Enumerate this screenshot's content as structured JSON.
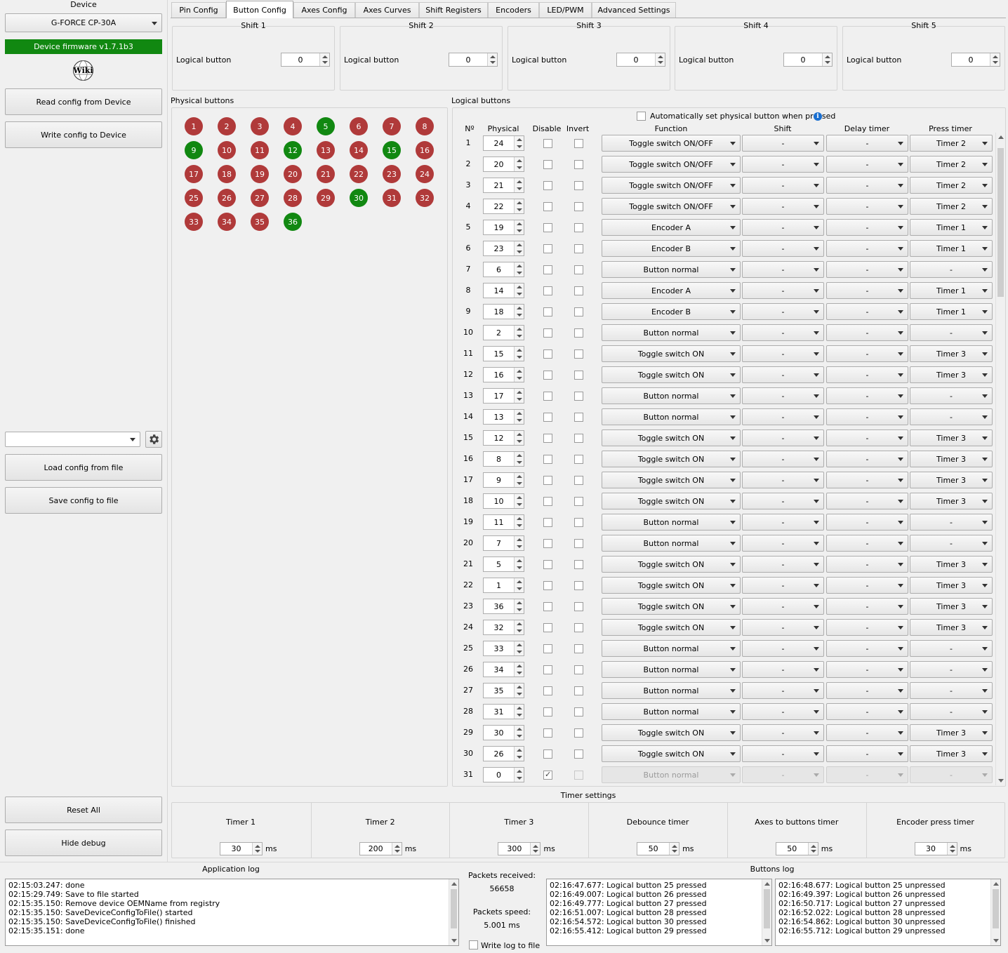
{
  "device": {
    "label": "Device",
    "selected": "G-FORCE CP-30A",
    "firmware": "Device firmware v1.7.1b3",
    "wiki": "Wiki",
    "read": "Read config from Device",
    "write": "Write config to Device",
    "load": "Load config from file",
    "save": "Save config to file",
    "reset": "Reset All",
    "hide_debug": "Hide debug",
    "config_select": ""
  },
  "tabs": [
    "Pin Config",
    "Button Config",
    "Axes Config",
    "Axes Curves",
    "Shift Registers",
    "Encoders",
    "LED/PWM",
    "Advanced Settings"
  ],
  "active_tab": 1,
  "shifts": [
    {
      "title": "Shift 1",
      "label": "Logical button",
      "value": "0"
    },
    {
      "title": "Shift 2",
      "label": "Logical button",
      "value": "0"
    },
    {
      "title": "Shift 3",
      "label": "Logical button",
      "value": "0"
    },
    {
      "title": "Shift 4",
      "label": "Logical button",
      "value": "0"
    },
    {
      "title": "Shift 5",
      "label": "Logical button",
      "value": "0"
    }
  ],
  "physical": {
    "title": "Physical buttons",
    "green": [
      5,
      9,
      12,
      15,
      30,
      36
    ],
    "buttons": [
      "1",
      "2",
      "3",
      "4",
      "5",
      "6",
      "7",
      "8",
      "9",
      "10",
      "11",
      "12",
      "13",
      "14",
      "15",
      "16",
      "17",
      "18",
      "19",
      "20",
      "21",
      "22",
      "23",
      "24",
      "25",
      "26",
      "27",
      "28",
      "29",
      "30",
      "31",
      "32",
      "33",
      "34",
      "35",
      "36"
    ]
  },
  "logical": {
    "title": "Logical buttons",
    "auto_set": "Automatically set physical button when pressed",
    "headers": {
      "num": "Nº",
      "physical": "Physical",
      "disable": "Disable",
      "invert": "Invert",
      "function": "Function",
      "shift": "Shift",
      "delay": "Delay timer",
      "press": "Press timer"
    },
    "rows": [
      {
        "n": "1",
        "p": "24",
        "f": "Toggle switch ON/OFF",
        "s": "-",
        "d": "-",
        "t": "Timer 2"
      },
      {
        "n": "2",
        "p": "20",
        "f": "Toggle switch ON/OFF",
        "s": "-",
        "d": "-",
        "t": "Timer 2"
      },
      {
        "n": "3",
        "p": "21",
        "f": "Toggle switch ON/OFF",
        "s": "-",
        "d": "-",
        "t": "Timer 2"
      },
      {
        "n": "4",
        "p": "22",
        "f": "Toggle switch ON/OFF",
        "s": "-",
        "d": "-",
        "t": "Timer 2"
      },
      {
        "n": "5",
        "p": "19",
        "f": "Encoder A",
        "s": "-",
        "d": "-",
        "t": "Timer 1"
      },
      {
        "n": "6",
        "p": "23",
        "f": "Encoder B",
        "s": "-",
        "d": "-",
        "t": "Timer 1"
      },
      {
        "n": "7",
        "p": "6",
        "f": "Button normal",
        "s": "-",
        "d": "-",
        "t": "-"
      },
      {
        "n": "8",
        "p": "14",
        "f": "Encoder A",
        "s": "-",
        "d": "-",
        "t": "Timer 1"
      },
      {
        "n": "9",
        "p": "18",
        "f": "Encoder B",
        "s": "-",
        "d": "-",
        "t": "Timer 1"
      },
      {
        "n": "10",
        "p": "2",
        "f": "Button normal",
        "s": "-",
        "d": "-",
        "t": "-"
      },
      {
        "n": "11",
        "p": "15",
        "f": "Toggle switch ON",
        "s": "-",
        "d": "-",
        "t": "Timer 3"
      },
      {
        "n": "12",
        "p": "16",
        "f": "Toggle switch ON",
        "s": "-",
        "d": "-",
        "t": "Timer 3"
      },
      {
        "n": "13",
        "p": "17",
        "f": "Button normal",
        "s": "-",
        "d": "-",
        "t": "-"
      },
      {
        "n": "14",
        "p": "13",
        "f": "Button normal",
        "s": "-",
        "d": "-",
        "t": "-"
      },
      {
        "n": "15",
        "p": "12",
        "f": "Toggle switch ON",
        "s": "-",
        "d": "-",
        "t": "Timer 3"
      },
      {
        "n": "16",
        "p": "8",
        "f": "Toggle switch ON",
        "s": "-",
        "d": "-",
        "t": "Timer 3"
      },
      {
        "n": "17",
        "p": "9",
        "f": "Toggle switch ON",
        "s": "-",
        "d": "-",
        "t": "Timer 3"
      },
      {
        "n": "18",
        "p": "10",
        "f": "Toggle switch ON",
        "s": "-",
        "d": "-",
        "t": "Timer 3"
      },
      {
        "n": "19",
        "p": "11",
        "f": "Button normal",
        "s": "-",
        "d": "-",
        "t": "-"
      },
      {
        "n": "20",
        "p": "7",
        "f": "Button normal",
        "s": "-",
        "d": "-",
        "t": "-"
      },
      {
        "n": "21",
        "p": "5",
        "f": "Toggle switch ON",
        "s": "-",
        "d": "-",
        "t": "Timer 3"
      },
      {
        "n": "22",
        "p": "1",
        "f": "Toggle switch ON",
        "s": "-",
        "d": "-",
        "t": "Timer 3"
      },
      {
        "n": "23",
        "p": "36",
        "f": "Toggle switch ON",
        "s": "-",
        "d": "-",
        "t": "Timer 3"
      },
      {
        "n": "24",
        "p": "32",
        "f": "Toggle switch ON",
        "s": "-",
        "d": "-",
        "t": "Timer 3"
      },
      {
        "n": "25",
        "p": "33",
        "f": "Button normal",
        "s": "-",
        "d": "-",
        "t": "-"
      },
      {
        "n": "26",
        "p": "34",
        "f": "Button normal",
        "s": "-",
        "d": "-",
        "t": "-"
      },
      {
        "n": "27",
        "p": "35",
        "f": "Button normal",
        "s": "-",
        "d": "-",
        "t": "-"
      },
      {
        "n": "28",
        "p": "31",
        "f": "Button normal",
        "s": "-",
        "d": "-",
        "t": "-"
      },
      {
        "n": "29",
        "p": "30",
        "f": "Toggle switch ON",
        "s": "-",
        "d": "-",
        "t": "Timer 3"
      },
      {
        "n": "30",
        "p": "26",
        "f": "Toggle switch ON",
        "s": "-",
        "d": "-",
        "t": "Timer 3"
      },
      {
        "n": "31",
        "p": "0",
        "f": "Button normal",
        "s": "-",
        "d": "-",
        "t": "-",
        "disabled": true
      }
    ]
  },
  "timers": {
    "title": "Timer settings",
    "items": [
      {
        "label": "Timer 1",
        "value": "30",
        "unit": "ms"
      },
      {
        "label": "Timer 2",
        "value": "200",
        "unit": "ms"
      },
      {
        "label": "Timer 3",
        "value": "300",
        "unit": "ms"
      },
      {
        "label": "Debounce timer",
        "value": "50",
        "unit": "ms"
      },
      {
        "label": "Axes to buttons timer",
        "value": "50",
        "unit": "ms"
      },
      {
        "label": "Encoder press timer",
        "value": "30",
        "unit": "ms"
      }
    ]
  },
  "app_log": {
    "title": "Application log",
    "lines": [
      "02:15:03.247: done",
      "02:15:29.749: Save to file started",
      "02:15:35.150: Remove device OEMName from registry",
      "02:15:35.150: SaveDeviceConfigToFile() started",
      "02:15:35.150: SaveDeviceConfigToFile() finished",
      "02:15:35.151: done"
    ]
  },
  "packets": {
    "received_label": "Packets received:",
    "received": "56658",
    "speed_label": "Packets speed:",
    "speed": "5.001 ms",
    "write_log": "Write log to file"
  },
  "buttons_log": {
    "title": "Buttons log",
    "pressed": [
      "02:16:47.677: Logical button 25 pressed",
      "02:16:49.007: Logical button 26 pressed",
      "02:16:49.777: Logical button 27 pressed",
      "02:16:51.007: Logical button 28 pressed",
      "02:16:54.572: Logical button 30 pressed",
      "02:16:55.412: Logical button 29 pressed"
    ],
    "unpressed": [
      "02:16:48.677: Logical button 25 unpressed",
      "02:16:49.397: Logical button 26 unpressed",
      "02:16:50.717: Logical button 27 unpressed",
      "02:16:52.022: Logical button 28 unpressed",
      "02:16:54.862: Logical button 30 unpressed",
      "02:16:55.712: Logical button 29 unpressed"
    ]
  },
  "colors": {
    "firmware_bg": "#118811",
    "button_red": "#b03a3a",
    "button_green": "#118811",
    "info": "#1a6fd0"
  }
}
